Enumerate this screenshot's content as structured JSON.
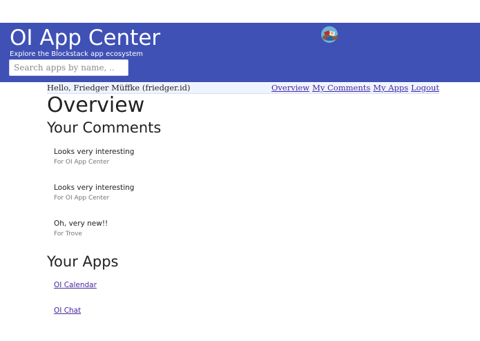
{
  "header": {
    "title": "OI App Center",
    "subtitle": "Explore the Blockstack app ecosystem",
    "search_placeholder": "Search apps by name, ..",
    "avatar_icon": "user-avatar-icon",
    "background_color": "#3f51b5"
  },
  "userbar": {
    "greeting": "Hello, Friedger Müffke (friedger.id)",
    "nav": [
      {
        "label": "Overview"
      },
      {
        "label": "My Comments"
      },
      {
        "label": "My Apps"
      },
      {
        "label": "Logout"
      }
    ]
  },
  "main": {
    "title": "Overview",
    "comments_heading": "Your Comments",
    "comments": [
      {
        "text": "Looks very interesting",
        "app": "For OI App Center"
      },
      {
        "text": "Looks very interesting",
        "app": "For OI App Center"
      },
      {
        "text": "Oh, very new!!",
        "app": "For Trove"
      }
    ],
    "apps_heading": "Your Apps",
    "apps": [
      {
        "label": "OI Calendar"
      },
      {
        "label": "OI Chat"
      }
    ]
  }
}
